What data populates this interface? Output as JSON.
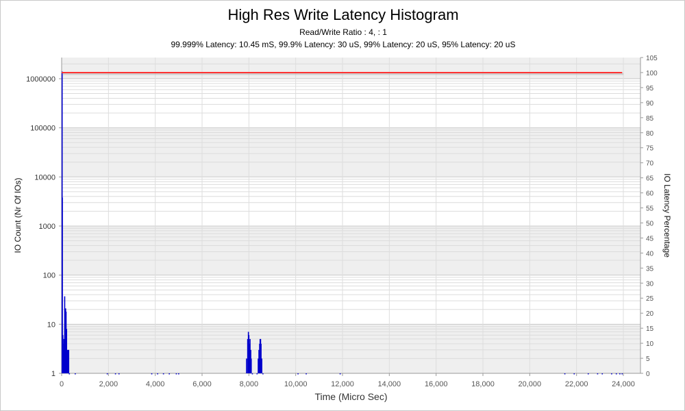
{
  "chart_data": {
    "type": "bar",
    "title": "High Res Write Latency Histogram",
    "subtitle_1": "Read/Write Ratio : 4,  : 1",
    "subtitle_2": "99.999% Latency: 10.45 mS, 99.9% Latency: 30 uS, 99% Latency: 20 uS, 95% Latency: 20 uS",
    "xlabel": "Time (Micro Sec)",
    "ylabel": "IO Count (Nr Of IOs)",
    "y2label": "IO Latency Percentage",
    "xlim": [
      0,
      24500
    ],
    "ylim": [
      1,
      2700000
    ],
    "y_scale": "log",
    "y2lim": [
      0,
      105
    ],
    "x_ticks": [
      0,
      2000,
      4000,
      6000,
      8000,
      10000,
      12000,
      14000,
      16000,
      18000,
      20000,
      22000,
      24000
    ],
    "x_tick_labels": [
      "0",
      "2,000",
      "4,000",
      "6,000",
      "8,000",
      "10,000",
      "12,000",
      "14,000",
      "16,000",
      "18,000",
      "20,000",
      "22,000",
      "24,000"
    ],
    "y_ticks": [
      1,
      10,
      100,
      1000,
      10000,
      100000,
      1000000
    ],
    "y_tick_labels": [
      "1",
      "10",
      "100",
      "1000",
      "10000",
      "100000",
      "1000000"
    ],
    "y2_ticks": [
      0,
      5,
      10,
      15,
      20,
      25,
      30,
      35,
      40,
      45,
      50,
      55,
      60,
      65,
      70,
      75,
      80,
      85,
      90,
      95,
      100,
      105
    ],
    "y2_tick_labels": [
      "0",
      "5",
      "10",
      "15",
      "20",
      "25",
      "30",
      "35",
      "40",
      "45",
      "50",
      "55",
      "60",
      "65",
      "70",
      "75",
      "80",
      "85",
      "90",
      "95",
      "100",
      "105"
    ],
    "grid": true,
    "series": [
      {
        "role": "io_count_histogram",
        "color": "#0000cc",
        "points": [
          [
            20,
            1400000
          ],
          [
            30,
            3800
          ],
          [
            50,
            6
          ],
          [
            60,
            4
          ],
          [
            80,
            3
          ],
          [
            100,
            5
          ],
          [
            110,
            2
          ],
          [
            130,
            37
          ],
          [
            150,
            14
          ],
          [
            170,
            21
          ],
          [
            190,
            18
          ],
          [
            210,
            8
          ],
          [
            230,
            3
          ],
          [
            250,
            2
          ],
          [
            270,
            3
          ],
          [
            300,
            3
          ],
          [
            330,
            1
          ],
          [
            580,
            1
          ],
          [
            1950,
            1
          ],
          [
            2300,
            1
          ],
          [
            2450,
            1
          ],
          [
            3850,
            1
          ],
          [
            4100,
            1
          ],
          [
            4350,
            1
          ],
          [
            4600,
            1
          ],
          [
            4900,
            1
          ],
          [
            5000,
            1
          ],
          [
            7900,
            2
          ],
          [
            7950,
            5
          ],
          [
            7980,
            7
          ],
          [
            8000,
            6
          ],
          [
            8020,
            4
          ],
          [
            8050,
            5
          ],
          [
            8080,
            3
          ],
          [
            8100,
            2
          ],
          [
            8150,
            1
          ],
          [
            8350,
            1
          ],
          [
            8400,
            2
          ],
          [
            8430,
            3
          ],
          [
            8460,
            4
          ],
          [
            8480,
            5
          ],
          [
            8500,
            5
          ],
          [
            8520,
            4
          ],
          [
            8550,
            2
          ],
          [
            8600,
            1
          ],
          [
            10100,
            1
          ],
          [
            10450,
            1
          ],
          [
            11900,
            1
          ],
          [
            21500,
            1
          ],
          [
            21900,
            1
          ],
          [
            22500,
            1
          ],
          [
            22900,
            1
          ],
          [
            23100,
            1
          ],
          [
            23500,
            1
          ],
          [
            23700,
            1
          ],
          [
            23850,
            1
          ],
          [
            23950,
            1
          ]
        ]
      },
      {
        "role": "cumulative_latency_percentage",
        "color": "#ff3333",
        "points": [
          [
            0,
            100
          ],
          [
            23950,
            100
          ]
        ]
      }
    ]
  }
}
